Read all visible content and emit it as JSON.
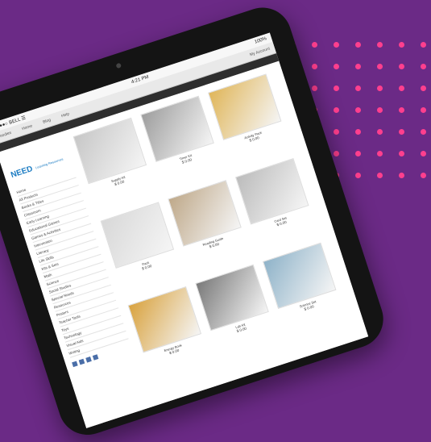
{
  "device": {
    "status_carrier": "●●●●○ BELL ☰",
    "status_time": "4:21 PM",
    "status_battery": "100%"
  },
  "browser": {
    "tabs": [
      "Goodies",
      "Home",
      "Blog",
      "Help"
    ],
    "cart": "My Account"
  },
  "site": {
    "logo_mark": "NEED",
    "logo_text": "Learning Resources",
    "categories": [
      "Home",
      "All Products",
      "Books & Titles",
      "Classroom",
      "Early Learning",
      "Educational Games",
      "Games & Activities",
      "Intervention",
      "Literacy",
      "Life Skills",
      "Kits & Sets",
      "Math",
      "Science",
      "Social Studies",
      "Special Needs",
      "Resources",
      "Posters",
      "Teacher Tools",
      "Toys",
      "Technology",
      "Visual Aids",
      "Writing"
    ],
    "products": [
      {
        "title": "Supply Kit",
        "price": "$ 0.00"
      },
      {
        "title": "Timer Kit",
        "price": "$ 0.00"
      },
      {
        "title": "Activity Pack",
        "price": "$ 0.00"
      },
      {
        "title": "Pack",
        "price": "$ 0.00"
      },
      {
        "title": "Reading Guide",
        "price": "$ 0.00"
      },
      {
        "title": "Card Set",
        "price": "$ 0.00"
      },
      {
        "title": "Energy Book",
        "price": "$ 0.00"
      },
      {
        "title": "Lab Kit",
        "price": "$ 0.00"
      },
      {
        "title": "Science Set",
        "price": "$ 0.00"
      }
    ]
  }
}
